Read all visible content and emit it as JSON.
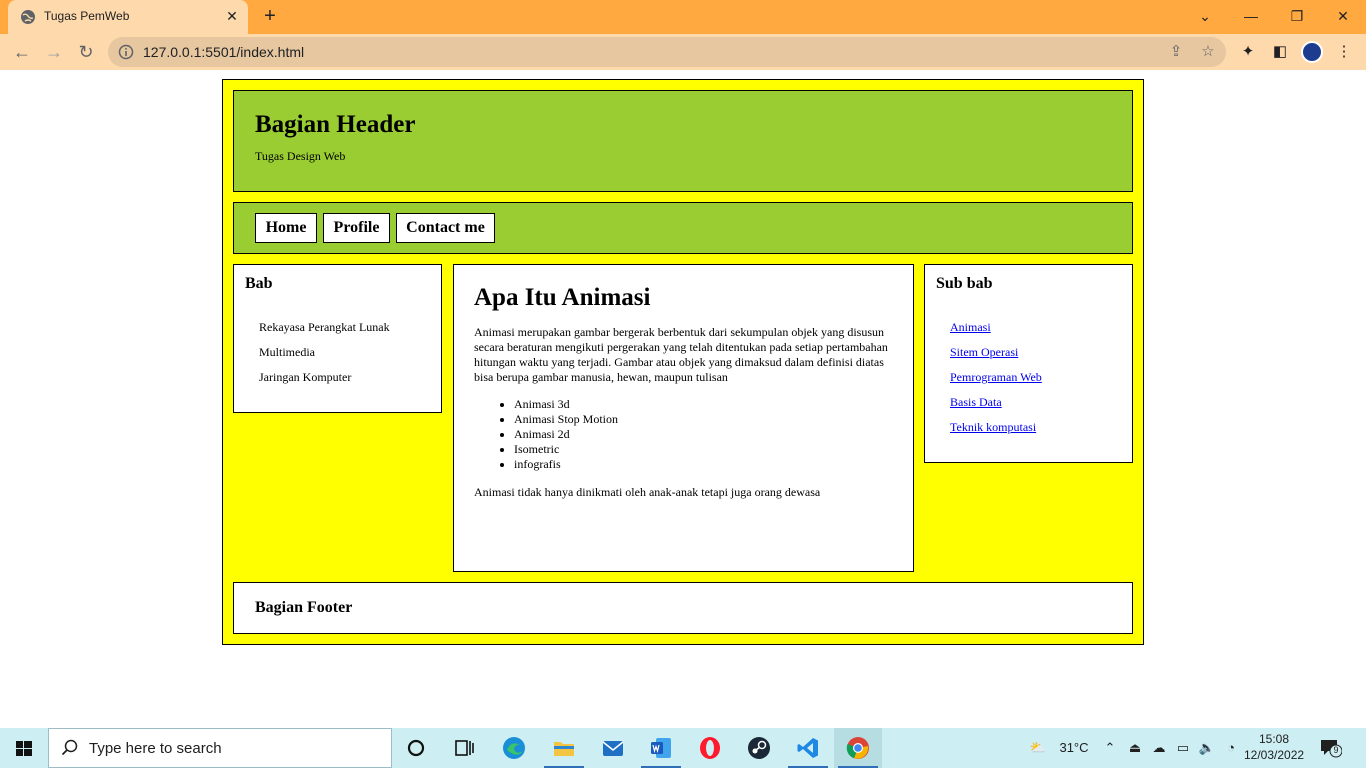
{
  "browser": {
    "tab_title": "Tugas PemWeb",
    "tab_close": "✕",
    "new_tab": "+",
    "url": "127.0.0.1:5501/index.html",
    "window_controls": [
      "⌄",
      "—",
      "❐",
      "✕"
    ]
  },
  "page": {
    "header": {
      "title": "Bagian Header",
      "subtitle": "Tugas Design Web"
    },
    "nav": [
      "Home",
      "Profile",
      "Contact me"
    ],
    "left_aside": {
      "title": "Bab",
      "items": [
        "Rekayasa Perangkat Lunak",
        "Multimedia",
        "Jaringan Komputer"
      ]
    },
    "main": {
      "title": "Apa Itu Animasi",
      "paragraph1": "Animasi merupakan gambar bergerak berbentuk dari sekumpulan objek yang disusun secara beraturan mengikuti pergerakan yang telah ditentukan pada setiap pertambahan hitungan waktu yang terjadi. Gambar atau objek yang dimaksud dalam definisi diatas bisa berupa gambar manusia, hewan, maupun tulisan",
      "list": [
        "Animasi 3d",
        "Animasi Stop Motion",
        "Animasi 2d",
        "Isometric",
        "infografis"
      ],
      "paragraph2": "Animasi tidak hanya dinikmati oleh anak-anak tetapi juga orang dewasa"
    },
    "right_aside": {
      "title": "Sub bab",
      "links": [
        "Animasi",
        "Sitem Operasi",
        "Pemrograman Web",
        "Basis Data",
        "Teknik komputasi"
      ]
    },
    "footer": {
      "title": "Bagian Footer"
    }
  },
  "taskbar": {
    "search_placeholder": "Type here to search",
    "temperature": "31°C",
    "time": "15:08",
    "date": "12/03/2022",
    "notification_count": "9"
  },
  "colors": {
    "tabbar": "#ffa940",
    "toolbar": "#fed9ab",
    "page_bg": "#ffff00",
    "header_bg": "#9acd32",
    "taskbar": "#cdeef2"
  }
}
